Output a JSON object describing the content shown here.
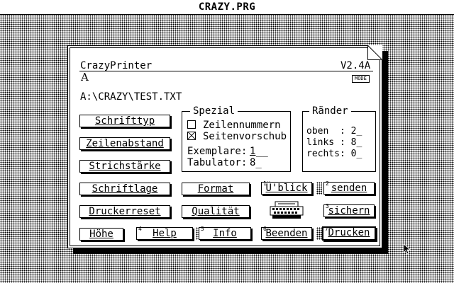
{
  "window": {
    "title": "CRAZY.PRG"
  },
  "dialog": {
    "app_name": "CrazyPrinter",
    "version": "V2.4A",
    "font_preview": "A",
    "mode_button": "MODE",
    "file_path": "A:\\CRAZY\\TEST.TXT"
  },
  "left_buttons": [
    "Schrifttyp",
    "Zeilenabstand",
    "Strichstärke",
    "Schriftlage",
    "Druckerreset",
    "Höhe"
  ],
  "spezial": {
    "title": "Spezial",
    "zeilennummern": {
      "label": "Zeilennummern",
      "checked": false
    },
    "seitenvorschub": {
      "label": "Seitenvorschub",
      "checked": true
    },
    "exemplare_label": "Exemplare:",
    "exemplare_value": "1",
    "exemplare_blanks": "__",
    "tabulator_label": "Tabulator:",
    "tabulator_value": "8_"
  },
  "raender": {
    "title": "Ränder",
    "oben": "oben  : 2_",
    "links": "links : 8_",
    "rechts": "rechts: 0_"
  },
  "mid_buttons": {
    "format": "Format",
    "qualitaet": "Qualität"
  },
  "right_buttons": {
    "ueberblick": {
      "num": "1",
      "label": "Ü'blick"
    },
    "senden": {
      "num": "2",
      "label": "senden"
    },
    "sichern": {
      "num": "3",
      "label": "sichern"
    }
  },
  "bottom_buttons": {
    "help": {
      "num": "4",
      "label": "Help"
    },
    "info": {
      "num": "5",
      "label": "Info"
    },
    "beenden": {
      "num": "6",
      "label": "Beenden"
    },
    "drucken": {
      "num": "7",
      "label": "Drucken"
    }
  },
  "icons": {
    "printer": "printer-icon",
    "cursor": "mouse-pointer-icon",
    "close_corner": "window-corner-icon"
  }
}
